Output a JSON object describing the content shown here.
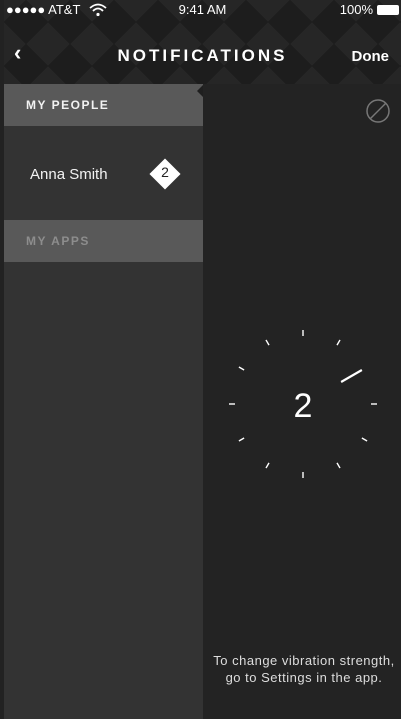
{
  "status_bar": {
    "carrier": "●●●●● AT&T",
    "time": "9:41 AM",
    "battery": "100%"
  },
  "nav": {
    "back_icon": "chevron-left-icon",
    "back_glyph": "‹",
    "title": "NOTIFICATIONS",
    "done_label": "Done"
  },
  "sidebar": {
    "people_header": "MY PEOPLE",
    "people": [
      {
        "name": "Anna Smith",
        "level": "2"
      }
    ],
    "apps_header": "MY APPS"
  },
  "content": {
    "block_icon": "block-icon",
    "strength": "2",
    "hint": "To change vibration strength, go to Settings in the app."
  },
  "colors": {
    "sidebar_bg": "#333333",
    "content_bg": "#232323",
    "header_bg": "#595959"
  }
}
